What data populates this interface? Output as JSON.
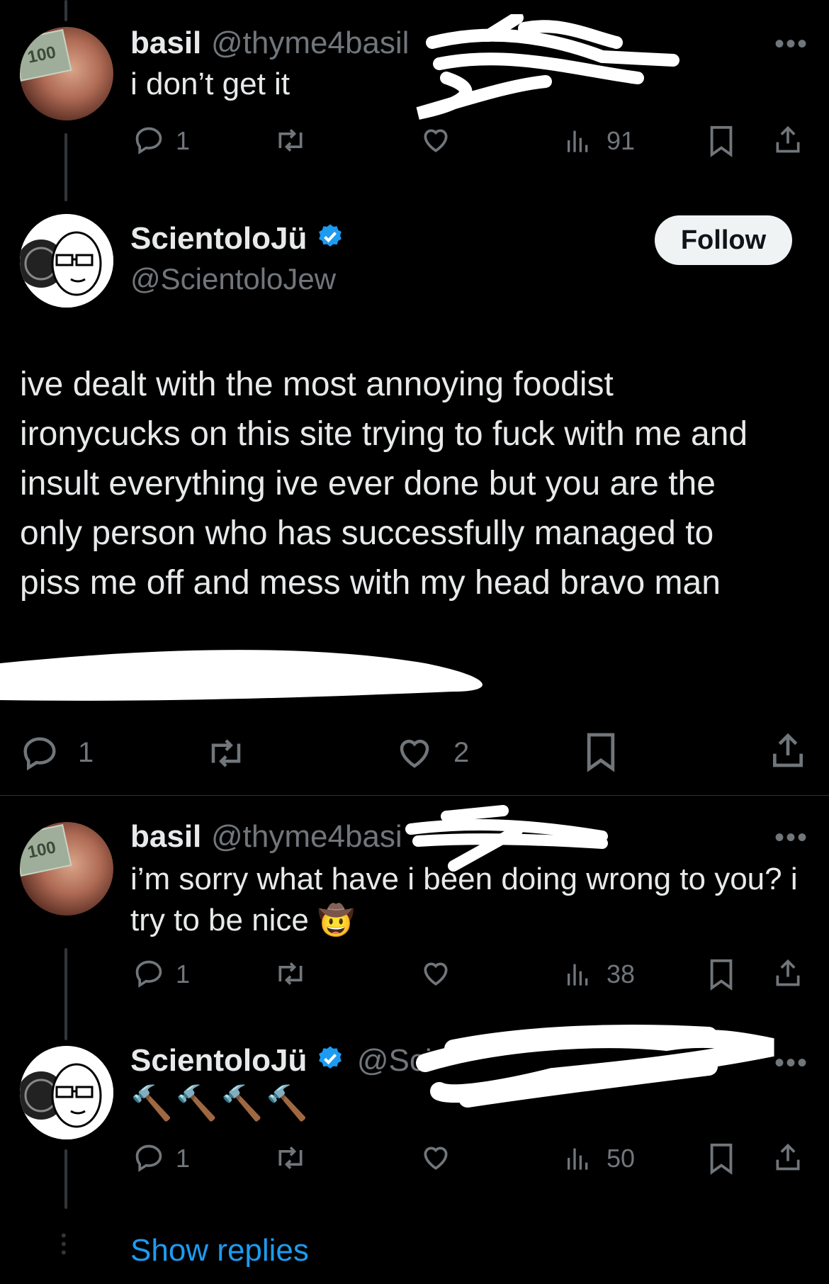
{
  "tweets": [
    {
      "name": "basil",
      "handle": "@thyme4basil",
      "text": "i don’t get it",
      "replies": "1",
      "views": "91"
    },
    {
      "name": "ScientoloJü",
      "handle": "@ScientoloJew",
      "follow_label": "Follow",
      "text_lines": [
        "ive dealt with the most annoying foodist",
        "ironycucks on this site trying to fuck with me and",
        "insult everything ive ever done but you are the",
        "only person who has successfully managed to",
        "piss me off and mess with my head bravo man"
      ],
      "replies": "1",
      "likes": "2"
    },
    {
      "name": "basil",
      "handle": "@thyme4basi",
      "text_line1": "i’m sorry what have i been doing wrong to you? i",
      "text_line2": "try to be nice",
      "emoji": "🤠",
      "replies": "1",
      "views": "38"
    },
    {
      "name": "ScientoloJü",
      "handle": "@Sci",
      "text": "🔨🔨🔨🔨",
      "replies": "1",
      "views": "50"
    }
  ],
  "show_replies_label": "Show replies",
  "colors": {
    "background": "#000000",
    "text": "#e7e9ea",
    "muted": "#71767b",
    "accent": "#1d9bf0",
    "follow_bg": "#eff3f4"
  }
}
